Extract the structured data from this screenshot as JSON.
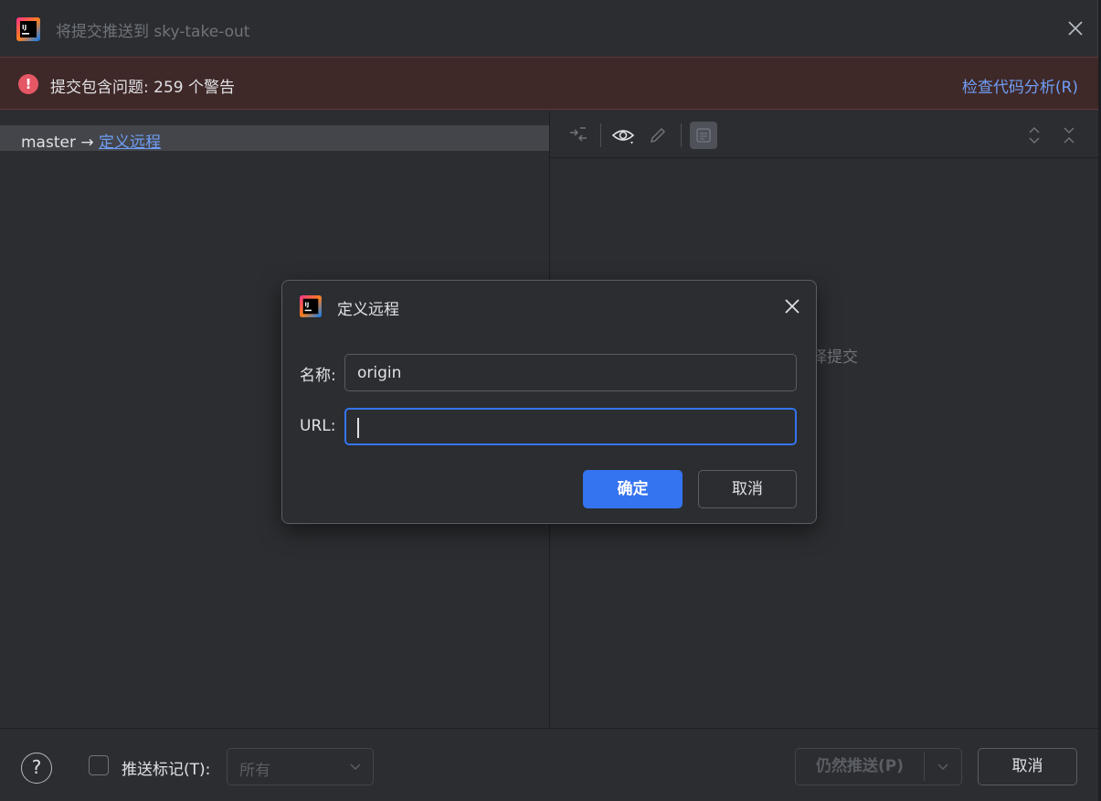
{
  "window": {
    "title": "将提交推送到 sky-take-out"
  },
  "banner": {
    "message": "提交包含问题: 259 个警告",
    "link": "检查代码分析(R)",
    "color": "#e55765"
  },
  "left": {
    "branch": "master",
    "arrow": "→",
    "remote_link": "定义远程"
  },
  "right": {
    "empty_text": "择提交"
  },
  "footer": {
    "help": "?",
    "push_tags_label": "推送标记(T):",
    "tags_select_value": "所有",
    "push_anyway": "仍然推送(P)",
    "cancel": "取消"
  },
  "dialog": {
    "title": "定义远程",
    "name_label": "名称:",
    "name_value": "origin",
    "url_label": "URL:",
    "url_value": "",
    "ok": "确定",
    "cancel": "取消",
    "accent": "#3574f0"
  }
}
